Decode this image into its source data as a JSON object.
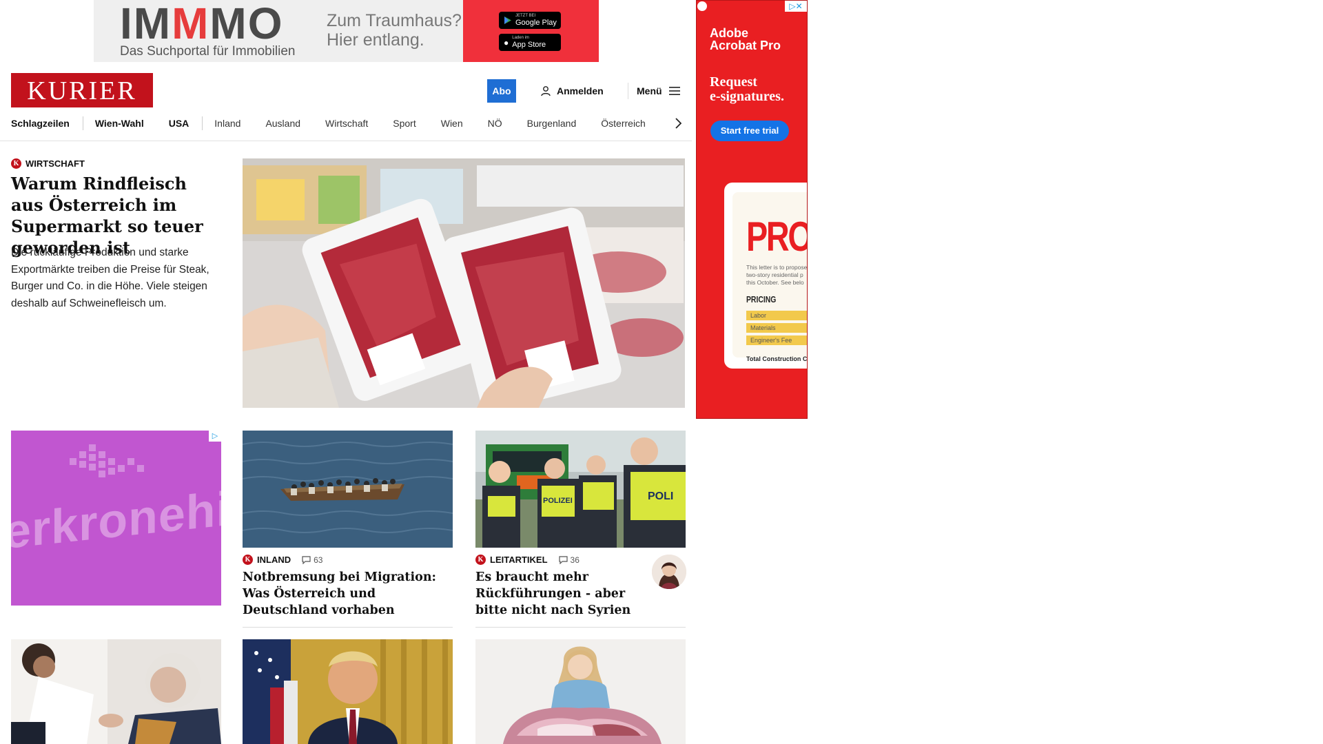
{
  "top_ad": {
    "logo_part1": "IM",
    "logo_part2": "M",
    "logo_part3": "MO",
    "tagline": "Das Suchportal für Immobilien",
    "claim_line1": "Zum Traumhaus?",
    "claim_line2": "Hier entlang.",
    "google_play_small": "JETZT BEI",
    "google_play": "Google Play",
    "app_store_small": "Laden im",
    "app_store": "App Store"
  },
  "header": {
    "logo": "KURIER",
    "abo": "Abo",
    "login": "Anmelden",
    "menu": "Menü"
  },
  "nav": {
    "items": [
      "Schlagzeilen",
      "Wien-Wahl",
      "USA",
      "Inland",
      "Ausland",
      "Wirtschaft",
      "Sport",
      "Wien",
      "NÖ",
      "Burgenland",
      "Österreich"
    ]
  },
  "lead": {
    "category": "WIRTSCHAFT",
    "title": "Warum Rindfleisch aus Österreich im Supermarkt so teuer geworden ist",
    "teaser": "Die rückläufige Produktion und starke Exportmärkte treiben die Preise für Steak, Burger und Co. in die Höhe. Viele steigen deshalb auf Schweinefleisch um."
  },
  "side_ad": {
    "brand_line1": "Adobe",
    "brand_line2": "Acrobat Pro",
    "headline_line1": "Request",
    "headline_line2": "e-signatures.",
    "cta": "Start free trial",
    "doc_title": "PROP",
    "doc_line1": "This letter is to propose",
    "doc_line2": "two-story residential p",
    "doc_line3": "this October. See belo",
    "pricing": "PRICING",
    "pricing_rows": [
      "Labor",
      "Materials",
      "Engineer's Fee"
    ],
    "total": "Total Construction Co"
  },
  "mid_ad": {
    "wordmark": "erkronehi"
  },
  "cards": [
    {
      "category": "INLAND",
      "comments": "63",
      "title": "Notbremsung bei Migration: Was Österreich und Deutschland vorhaben"
    },
    {
      "category": "LEITARTIKEL",
      "comments": "36",
      "title": "Es braucht mehr Rückführungen - aber bitte nicht nach Syrien"
    }
  ],
  "police_label": "POLIZEI",
  "police_label2": "POLI",
  "colors": {
    "kurier_red": "#c2121c",
    "abo_blue": "#1f6ed4",
    "adobe_red": "#e91f22",
    "mid_ad_purple": "#c156d0"
  }
}
